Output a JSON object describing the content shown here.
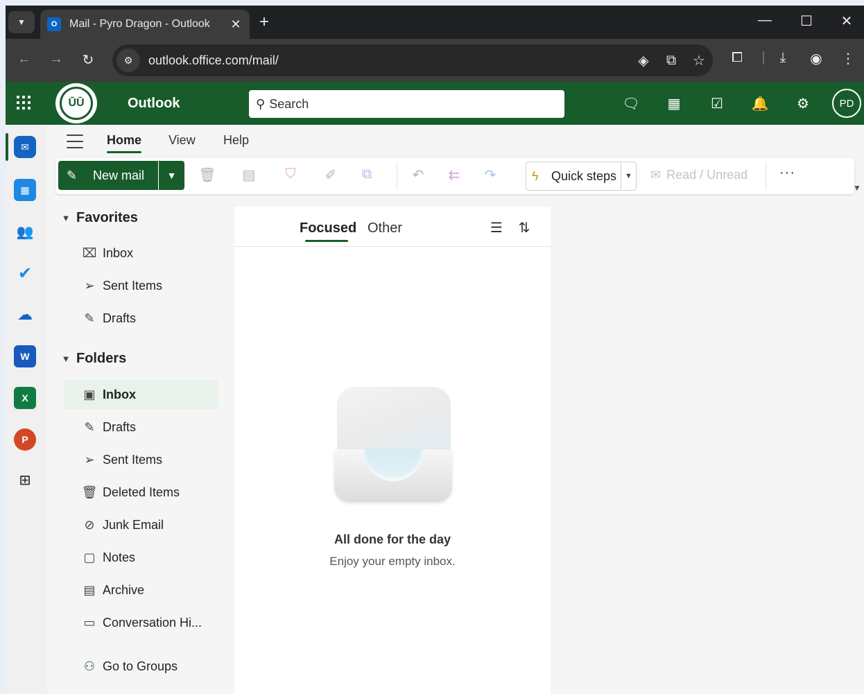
{
  "browser": {
    "tab_title": "Mail - Pyro Dragon - Outlook",
    "tab_close": "✕",
    "new_tab": "+",
    "url": "outlook.office.com/mail/",
    "win_min": "—",
    "win_max": "☐",
    "win_close": "✕"
  },
  "header": {
    "app_name": "Outlook",
    "logo_text": "ŪŪ",
    "search_placeholder": "Search",
    "avatar_initials": "PD"
  },
  "ribbon_tabs": {
    "home": "Home",
    "view": "View",
    "help": "Help"
  },
  "ribbon": {
    "new_mail": "New mail",
    "quick_steps": "Quick steps",
    "read_unread": "Read / Unread",
    "more": "···"
  },
  "favorites": {
    "title": "Favorites",
    "items": [
      {
        "label": "Inbox"
      },
      {
        "label": "Sent Items"
      },
      {
        "label": "Drafts"
      }
    ]
  },
  "folders": {
    "title": "Folders",
    "items": [
      {
        "label": "Inbox"
      },
      {
        "label": "Drafts"
      },
      {
        "label": "Sent Items"
      },
      {
        "label": "Deleted Items"
      },
      {
        "label": "Junk Email"
      },
      {
        "label": "Notes"
      },
      {
        "label": "Archive"
      },
      {
        "label": "Conversation Hi..."
      }
    ],
    "go_to_groups": "Go to Groups"
  },
  "message_list": {
    "tab_focused": "Focused",
    "tab_other": "Other",
    "empty_title": "All done for the day",
    "empty_subtitle": "Enjoy your empty inbox."
  },
  "colors": {
    "brand": "#185c2c",
    "selected_folder_bg": "#e8f1ea"
  }
}
